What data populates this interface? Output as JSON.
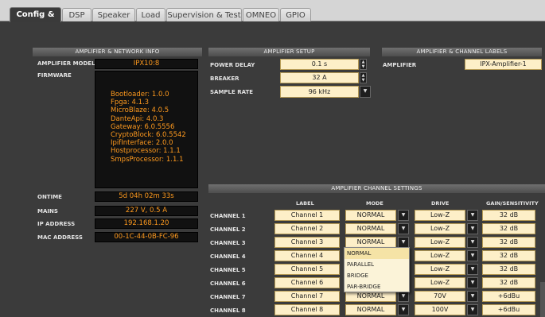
{
  "tabs": [
    "Config & Info",
    "DSP",
    "Speaker",
    "Load",
    "Supervision & Test",
    "OMNEO",
    "GPIO"
  ],
  "amp_net": {
    "header": "AMPLIFIER & NETWORK INFO",
    "model_label": "AMPLIFIER MODEL",
    "model": "IPX10:8",
    "firmware_label": "FIRMWARE",
    "firmware": [
      "Bootloader:  1.0.0",
      "Fpga:  4.1.3",
      "MicroBlaze:  4.0.5",
      "DanteApi:  4.0.3",
      "Gateway:  6.0.5556",
      "CryptoBlock:  6.0.5542",
      "IpifInterface:  2.0.0",
      "Hostprocessor:  1.1.1",
      "SmpsProcessor:  1.1.1"
    ],
    "ontime_label": "ONTIME",
    "ontime": "5d 04h 02m 33s",
    "mains_label": "MAINS",
    "mains": "227 V, 0.5 A",
    "ip_label": "IP ADDRESS",
    "ip": "192.168.1.20",
    "mac_label": "MAC ADDRESS",
    "mac": "00-1C-44-0B-FC-96"
  },
  "setup": {
    "header": "AMPLIFIER SETUP",
    "power_delay_label": "POWER DELAY",
    "power_delay": "0.1 s",
    "breaker_label": "BREAKER",
    "breaker": "32 A",
    "sample_rate_label": "SAMPLE RATE",
    "sample_rate": "96 kHz"
  },
  "labels": {
    "header": "AMPLIFIER & CHANNEL LABELS",
    "amp_label": "AMPLIFIER",
    "amp_name": "IPX-Amplifier-1"
  },
  "channels": {
    "header": "AMPLIFIER CHANNEL SETTINGS",
    "col_label": "LABEL",
    "col_mode": "MODE",
    "col_drive": "DRIVE",
    "col_gain": "GAIN/SENSITIVITY",
    "rows": [
      {
        "name": "CHANNEL 1",
        "label": "Channel 1",
        "mode": "NORMAL",
        "drive": "Low-Z",
        "gain": "32 dB"
      },
      {
        "name": "CHANNEL 2",
        "label": "Channel 2",
        "mode": "NORMAL",
        "drive": "Low-Z",
        "gain": "32 dB"
      },
      {
        "name": "CHANNEL 3",
        "label": "Channel 3",
        "mode": "NORMAL",
        "drive": "Low-Z",
        "gain": "32 dB"
      },
      {
        "name": "CHANNEL 4",
        "label": "Channel 4",
        "mode": "",
        "drive": "Low-Z",
        "gain": "32 dB"
      },
      {
        "name": "CHANNEL 5",
        "label": "Channel 5",
        "mode": "",
        "drive": "Low-Z",
        "gain": "32 dB"
      },
      {
        "name": "CHANNEL 6",
        "label": "Channel 6",
        "mode": "",
        "drive": "Low-Z",
        "gain": "32 dB"
      },
      {
        "name": "CHANNEL 7",
        "label": "Channel 7",
        "mode": "NORMAL",
        "drive": "70V",
        "gain": "+6dBu"
      },
      {
        "name": "CHANNEL 8",
        "label": "Channel 8",
        "mode": "NORMAL",
        "drive": "100V",
        "gain": "+6dBu"
      }
    ]
  },
  "mode_menu": {
    "options": [
      "NORMAL",
      "PARALLEL",
      "BRIDGE",
      "PAR-BRIDGE"
    ]
  }
}
